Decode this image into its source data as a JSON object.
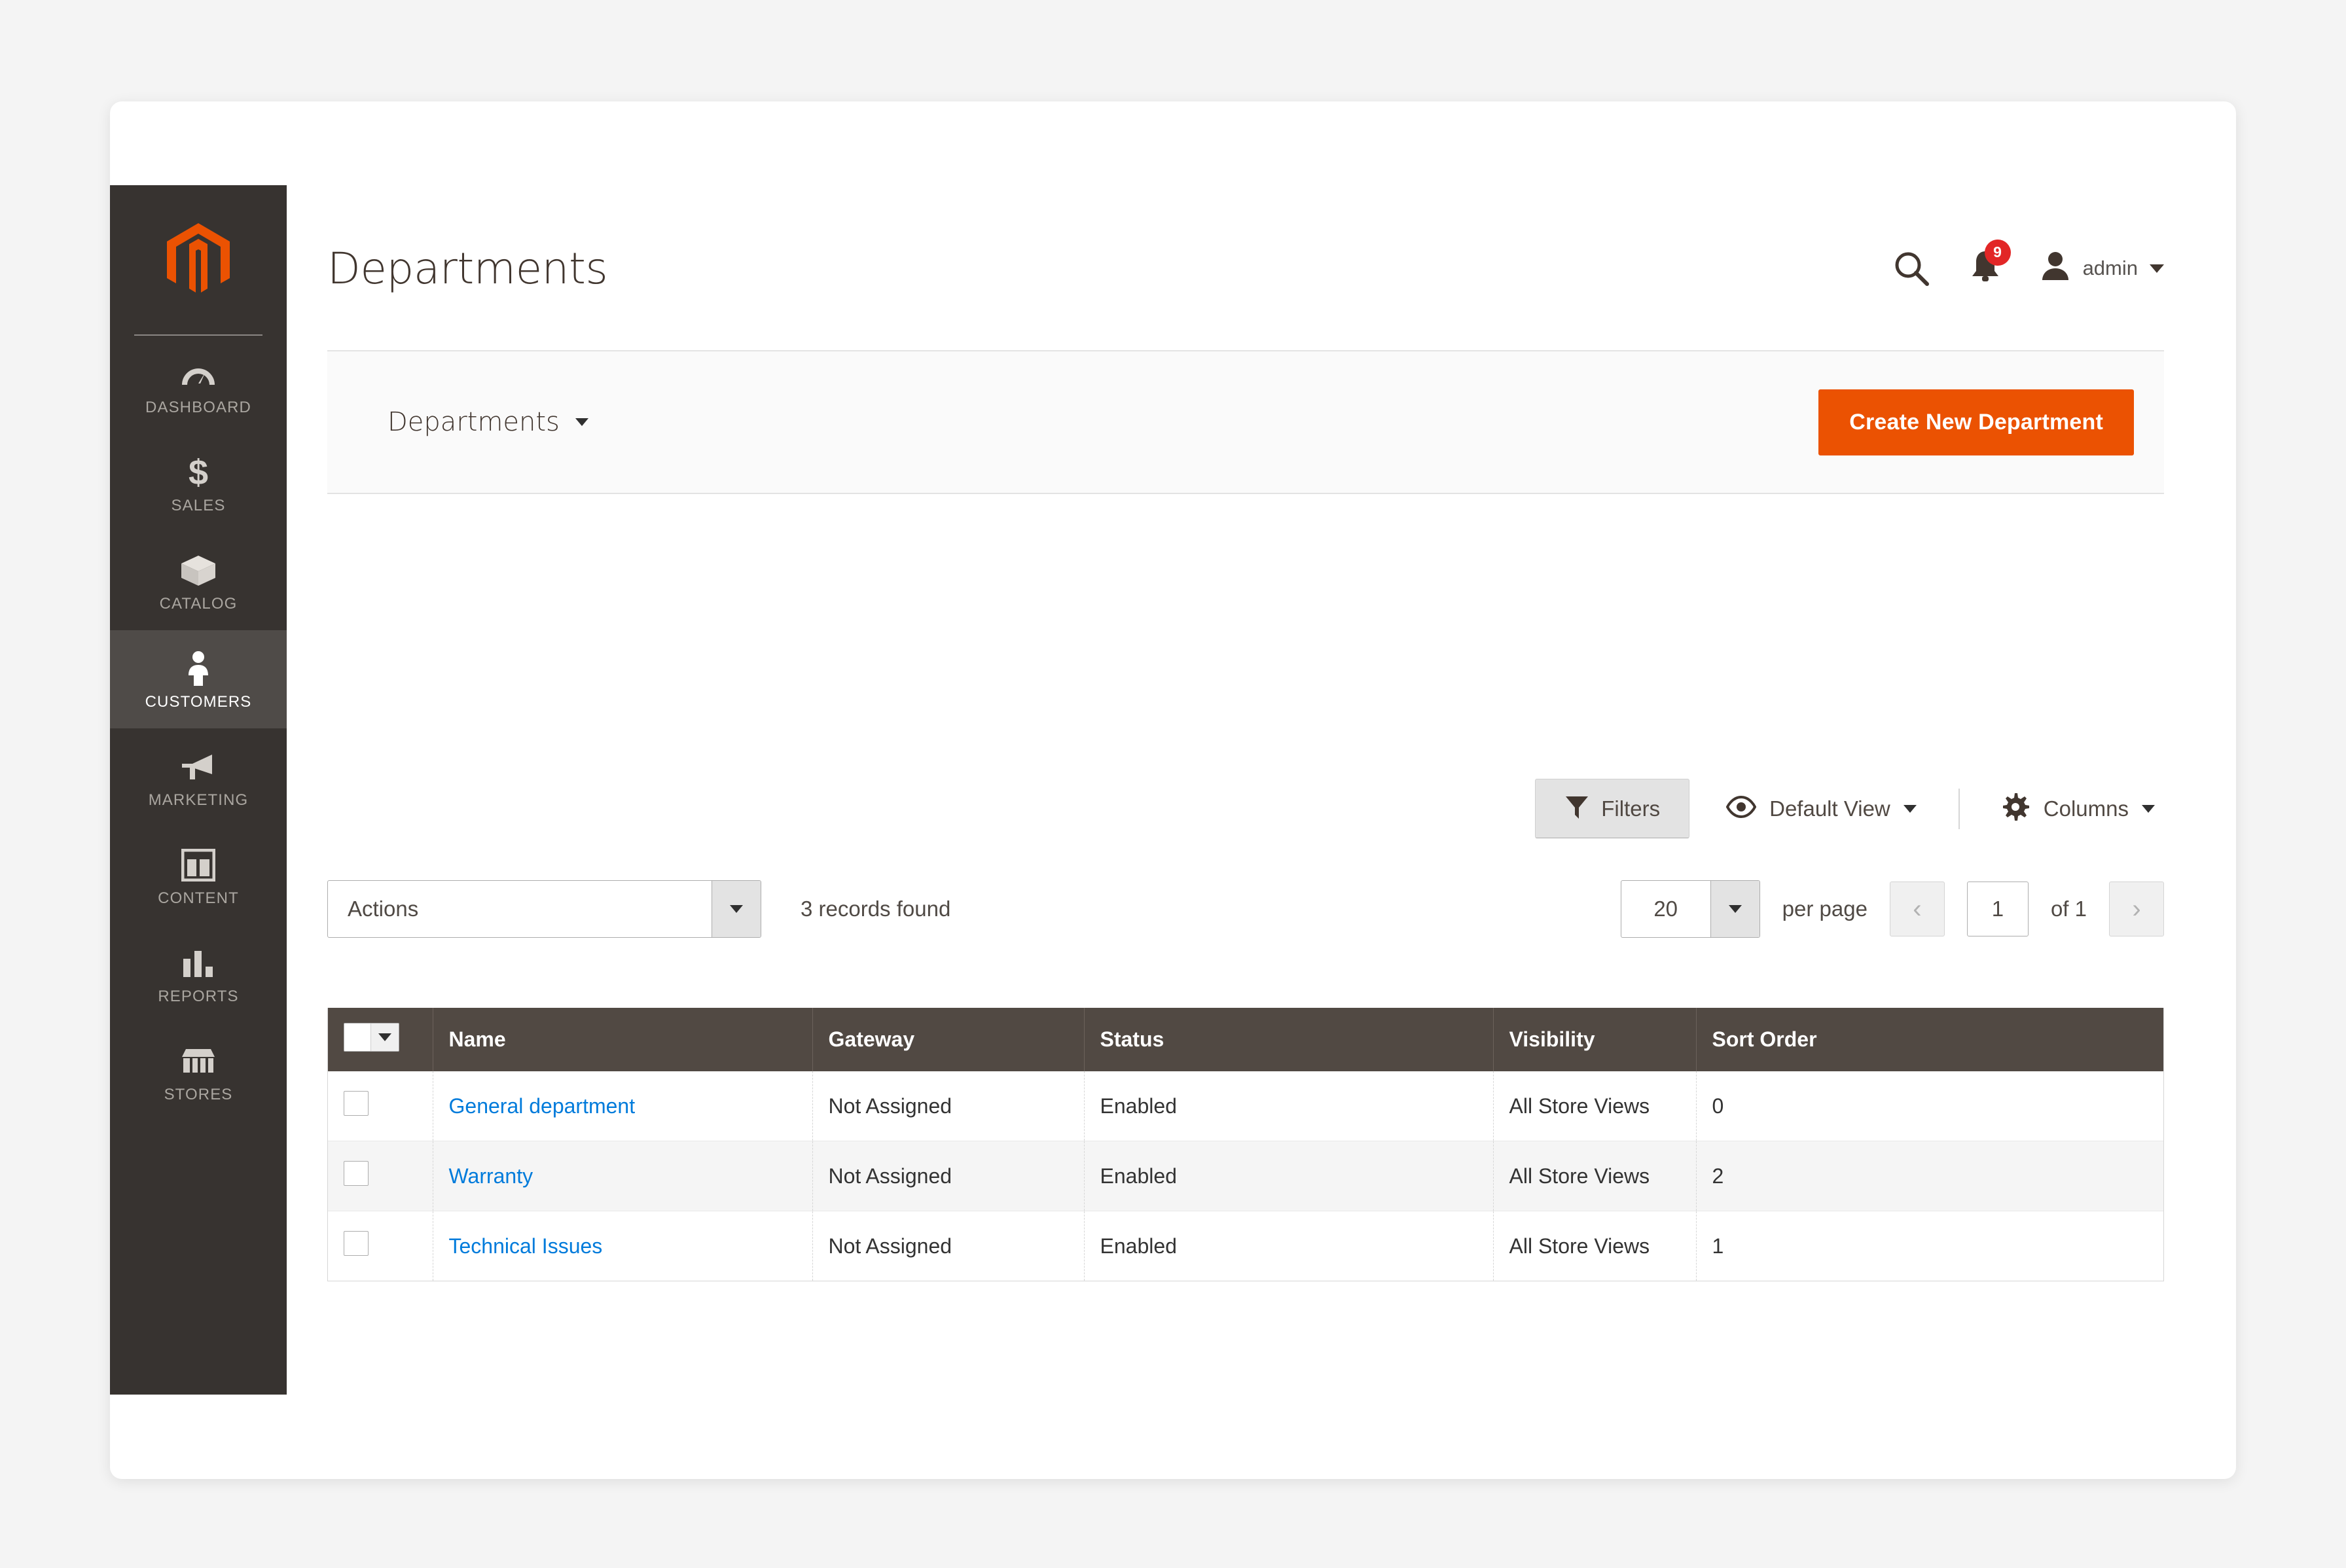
{
  "sidebar": {
    "logo": "magento-logo",
    "items": [
      {
        "label": "DASHBOARD",
        "icon": "dashboard-icon",
        "active": false
      },
      {
        "label": "SALES",
        "icon": "dollar-icon",
        "active": false
      },
      {
        "label": "CATALOG",
        "icon": "box-icon",
        "active": false
      },
      {
        "label": "CUSTOMERS",
        "icon": "person-icon",
        "active": true
      },
      {
        "label": "MARKETING",
        "icon": "megaphone-icon",
        "active": false
      },
      {
        "label": "CONTENT",
        "icon": "layout-icon",
        "active": false
      },
      {
        "label": "REPORTS",
        "icon": "bar-chart-icon",
        "active": false
      },
      {
        "label": "STORES",
        "icon": "storefront-icon",
        "active": false
      }
    ]
  },
  "header": {
    "title": "Departments",
    "search_icon": "search-icon",
    "notifications_icon": "bell-icon",
    "notifications_count": "9",
    "user_icon": "user-avatar-icon",
    "user_name": "admin"
  },
  "page_actions": {
    "breadcrumb_label": "Departments",
    "create_button": "Create New Department"
  },
  "grid_toolbar": {
    "filters_label": "Filters",
    "filters_icon": "funnel-icon",
    "view_icon": "eye-icon",
    "view_label": "Default View",
    "columns_icon": "gear-icon",
    "columns_label": "Columns"
  },
  "grid_controls": {
    "actions_label": "Actions",
    "records_found": "3 records found",
    "per_page_value": "20",
    "per_page_label": "per page",
    "prev_label": "‹",
    "page_value": "1",
    "of_label": "of 1",
    "next_label": "›"
  },
  "grid": {
    "columns": [
      "",
      "Name",
      "Gateway",
      "Status",
      "Visibility",
      "Sort Order"
    ],
    "rows": [
      {
        "name": "General department",
        "gateway": "Not Assigned",
        "status": "Enabled",
        "visibility": "All Store Views",
        "sort_order": "0"
      },
      {
        "name": "Warranty",
        "gateway": "Not Assigned",
        "status": "Enabled",
        "visibility": "All Store Views",
        "sort_order": "2"
      },
      {
        "name": "Technical Issues",
        "gateway": "Not Assigned",
        "status": "Enabled",
        "visibility": "All Store Views",
        "sort_order": "1"
      }
    ]
  },
  "colors": {
    "brand_orange": "#eb5202",
    "sidebar_bg": "#373330",
    "sidebar_active_bg": "#4f4b48",
    "grid_header_bg": "#514943",
    "link_blue": "#007bdb",
    "badge_red": "#e22626"
  }
}
